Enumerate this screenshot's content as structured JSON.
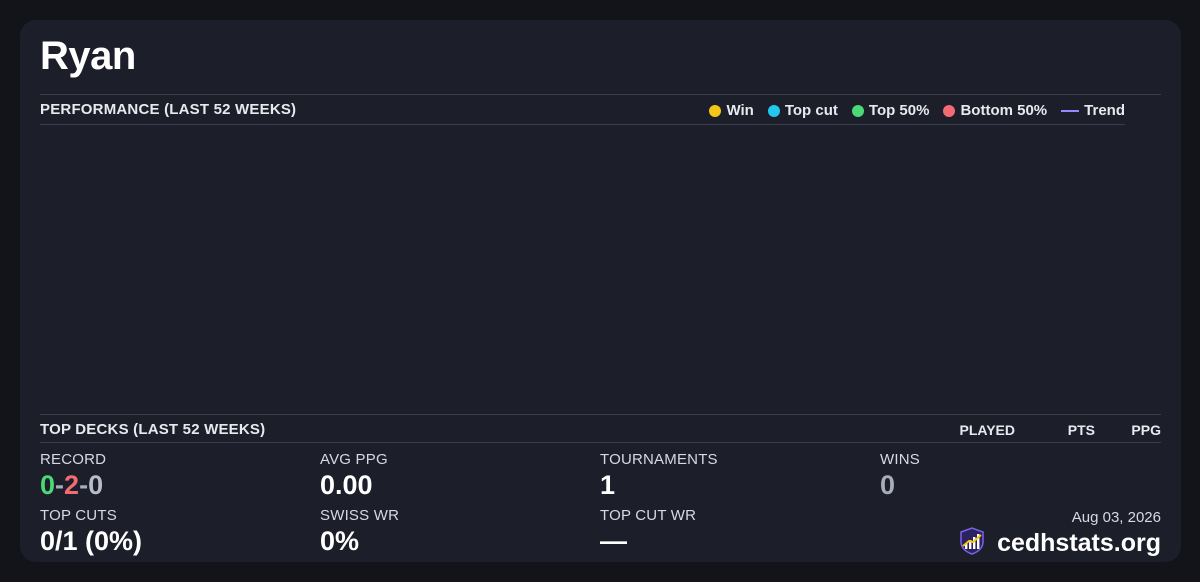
{
  "player": {
    "name": "Ryan"
  },
  "performance": {
    "title": "PERFORMANCE (LAST 52 WEEKS)",
    "legend": [
      {
        "label": "Win",
        "color": "#f5c518",
        "kind": "dot",
        "icon": "win-dot-icon"
      },
      {
        "label": "Top cut",
        "color": "#22c8ee",
        "kind": "dot",
        "icon": "top-cut-dot-icon"
      },
      {
        "label": "Top 50%",
        "color": "#4ad976",
        "kind": "dot",
        "icon": "top-50-dot-icon"
      },
      {
        "label": "Bottom 50%",
        "color": "#f26b73",
        "kind": "dot",
        "icon": "bottom-50-dot-icon"
      },
      {
        "label": "Trend",
        "color": "#9a87ff",
        "kind": "line",
        "icon": "trend-line-icon"
      }
    ]
  },
  "top_decks": {
    "title": "TOP DECKS (LAST 52 WEEKS)",
    "columns": [
      "PLAYED",
      "PTS",
      "PPG"
    ]
  },
  "stats": {
    "record": {
      "label": "RECORD",
      "wins": "0",
      "sep1": "-",
      "losses": "2",
      "sep2": "-",
      "draws": "0",
      "win_color": "#4ad976",
      "loss_color": "#f26b73",
      "draw_color": "#b9bccb"
    },
    "avg_ppg": {
      "label": "AVG PPG",
      "value": "0.00"
    },
    "tournaments": {
      "label": "TOURNAMENTS",
      "value": "1"
    },
    "wins": {
      "label": "WINS",
      "value": "0"
    },
    "top_cuts": {
      "label": "TOP CUTS",
      "value": "0/1 (0%)"
    },
    "swiss_wr": {
      "label": "SWISS WR",
      "value": "0%"
    },
    "top_cut_wr": {
      "label": "TOP CUT WR",
      "value": "—"
    }
  },
  "footer": {
    "date": "Aug 03, 2026",
    "brand": "cedhstats.org",
    "brand_icon": "cedhstats-logo-icon"
  }
}
